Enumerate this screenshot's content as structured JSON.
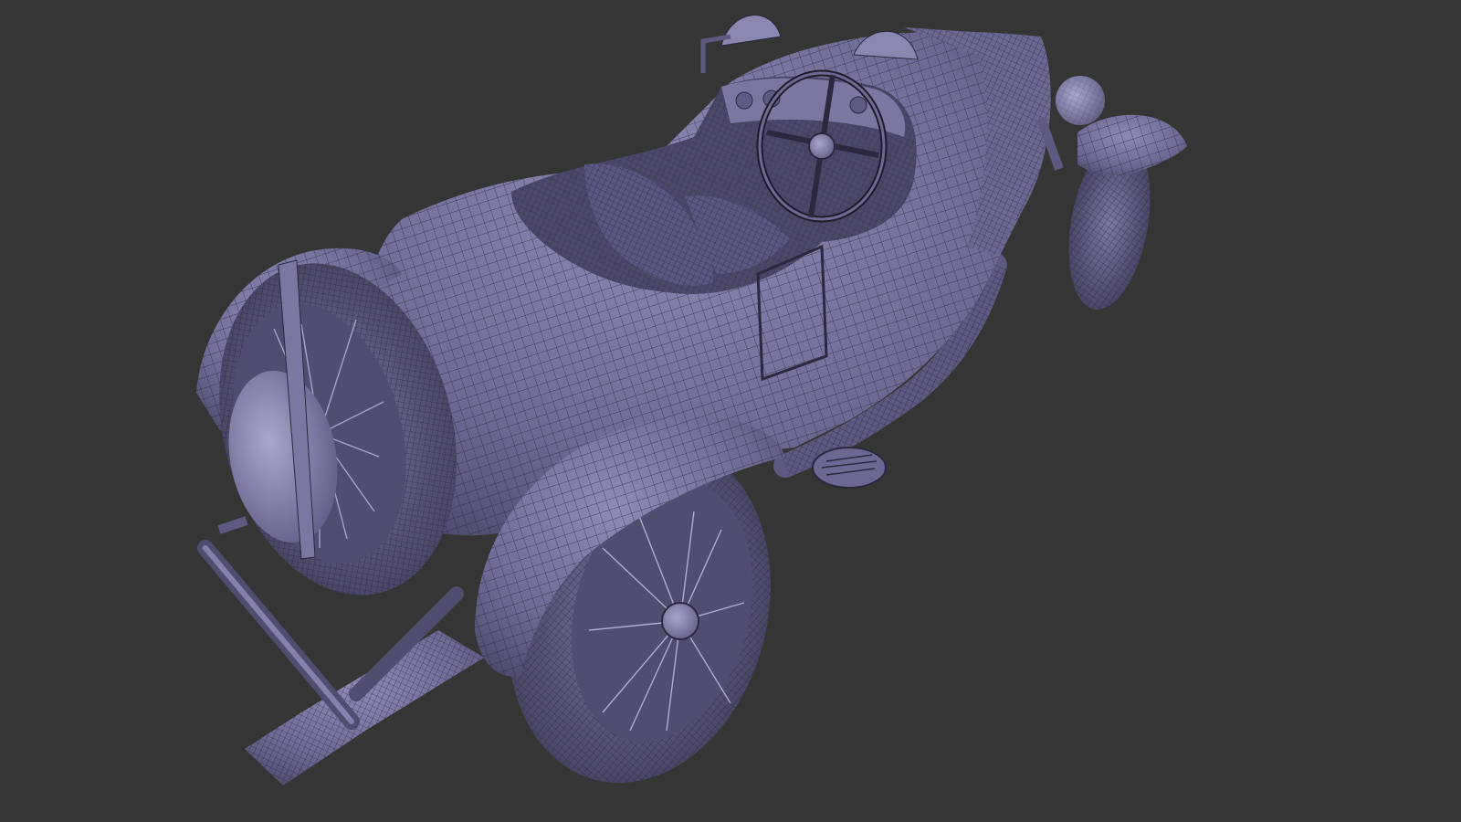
{
  "viewport": {
    "background": "#353535",
    "model_fill": "#6d6b94",
    "model_light": "#9391b8",
    "model_dark": "#4a4868",
    "wire_color": "#2a2940"
  }
}
